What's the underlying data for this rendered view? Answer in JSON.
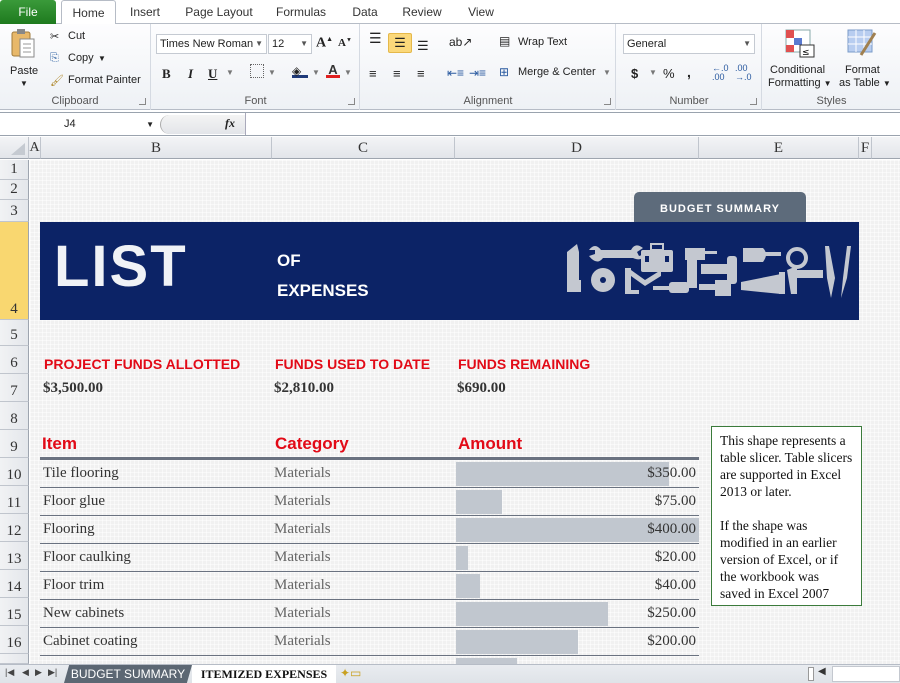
{
  "ribbon": {
    "tabs": [
      "File",
      "Home",
      "Insert",
      "Page Layout",
      "Formulas",
      "Data",
      "Review",
      "View"
    ],
    "active_tab": "Home",
    "clipboard": {
      "paste": "Paste",
      "cut": "Cut",
      "copy": "Copy",
      "format_painter": "Format Painter",
      "label": "Clipboard"
    },
    "font": {
      "family": "Times New Roman",
      "size": "12",
      "bold": "B",
      "italic": "I",
      "underline": "U",
      "label": "Font"
    },
    "alignment": {
      "wrap_text": "Wrap Text",
      "merge_center": "Merge & Center",
      "label": "Alignment"
    },
    "number": {
      "format": "General",
      "currency": "$",
      "percent": "%",
      "comma": ",",
      "label": "Number"
    },
    "styles": {
      "conditional_1": "Conditional",
      "conditional_2": "Formatting",
      "format_1": "Format",
      "format_2": "as Table",
      "label": "Styles"
    }
  },
  "formula_bar": {
    "name_box": "J4",
    "fx": "fx",
    "value": ""
  },
  "columns": [
    "A",
    "B",
    "C",
    "D",
    "E",
    "F"
  ],
  "rows": [
    "1",
    "2",
    "3",
    "4",
    "5",
    "6",
    "7",
    "8",
    "9",
    "10",
    "11",
    "12",
    "13",
    "14",
    "15",
    "16"
  ],
  "selected_row": "4",
  "sheet": {
    "budget_summary_button": "BUDGET SUMMARY",
    "banner": {
      "title_big": "LIST",
      "title_line1": "OF",
      "title_line2": "EXPENSES"
    },
    "stats": [
      {
        "label": "PROJECT FUNDS ALLOTTED",
        "value": "$3,500.00"
      },
      {
        "label": "FUNDS USED TO DATE",
        "value": "$2,810.00"
      },
      {
        "label": "FUNDS REMAINING",
        "value": "$690.00"
      }
    ],
    "table": {
      "headers": {
        "item": "Item",
        "category": "Category",
        "amount": "Amount"
      },
      "max_amount": 400,
      "rows": [
        {
          "item": "Tile flooring",
          "category": "Materials",
          "amount": "$350.00",
          "value": 350
        },
        {
          "item": "Floor glue",
          "category": "Materials",
          "amount": "$75.00",
          "value": 75
        },
        {
          "item": "Flooring",
          "category": "Materials",
          "amount": "$400.00",
          "value": 400
        },
        {
          "item": "Floor caulking",
          "category": "Materials",
          "amount": "$20.00",
          "value": 20
        },
        {
          "item": "Floor trim",
          "category": "Materials",
          "amount": "$40.00",
          "value": 40
        },
        {
          "item": "New cabinets",
          "category": "Materials",
          "amount": "$250.00",
          "value": 250
        },
        {
          "item": "Cabinet coating",
          "category": "Materials",
          "amount": "$200.00",
          "value": 200
        },
        {
          "item": "",
          "category": "",
          "amount": "",
          "value": 100
        }
      ]
    },
    "slicer_note": {
      "p1": "This shape represents a table slicer. Table slicers are supported in Excel 2013 or later.",
      "p2": "If the shape was modified in an earlier version of Excel, or if the workbook was saved in Excel 2007"
    }
  },
  "sheet_tabs": [
    {
      "label": "BUDGET SUMMARY",
      "active": false
    },
    {
      "label": "ITEMIZED EXPENSES",
      "active": true
    }
  ],
  "colors": {
    "banner": "#0c2366",
    "accent_red": "#e20a17",
    "bar": "#c1c7cf",
    "tab_gray": "#5d6b7b"
  }
}
